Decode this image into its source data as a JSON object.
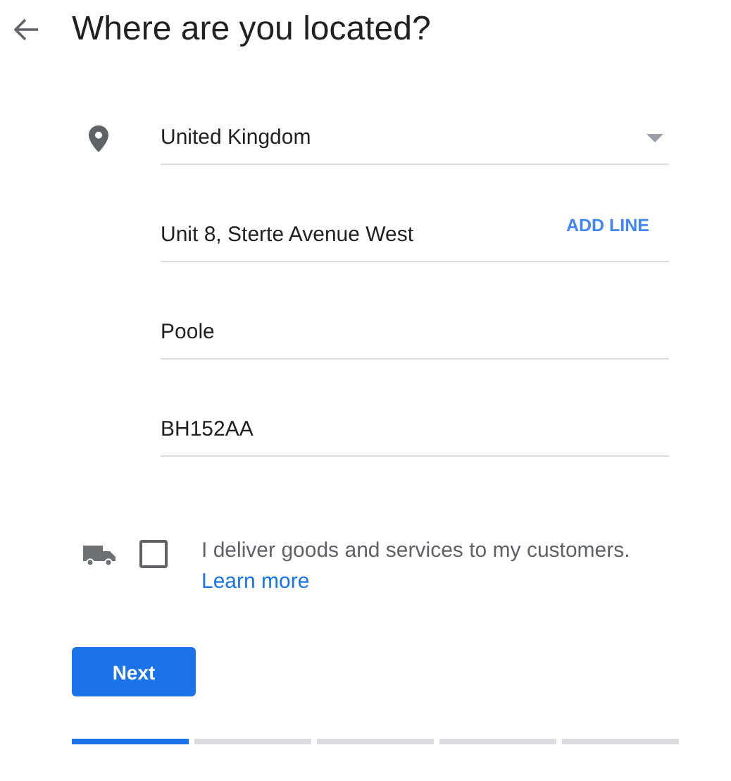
{
  "header": {
    "title": "Where are you located?"
  },
  "fields": [
    {
      "kind": "dropdown",
      "value": "United Kingdom"
    },
    {
      "kind": "text",
      "value": "Unit 8, Sterte Avenue West",
      "action": "ADD LINE"
    },
    {
      "kind": "text",
      "value": "Poole"
    },
    {
      "kind": "text",
      "value": "BH152AA"
    }
  ],
  "delivery": {
    "checked": false,
    "label": "I deliver goods and services to my customers.",
    "link": "Learn more"
  },
  "button": "Next",
  "steps": [
    {
      "selected": true
    },
    {
      "selected": false
    },
    {
      "selected": false
    },
    {
      "selected": false
    },
    {
      "selected": false
    }
  ]
}
